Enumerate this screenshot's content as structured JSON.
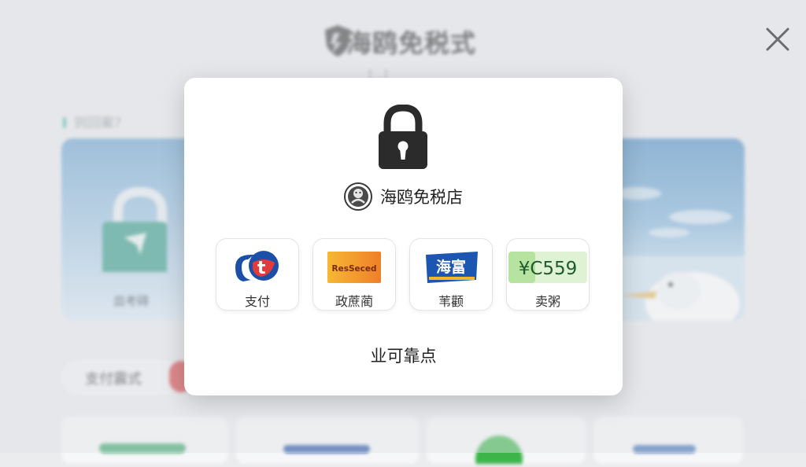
{
  "background": {
    "title": "海鸥免税式",
    "subtitle": "[...]",
    "section_label": "则回案?",
    "left_card_caption": "皿考碍",
    "payment_label": "支付震式"
  },
  "modal": {
    "brand_name": "海鸥免税店",
    "footer_text": "业可靠点",
    "payment_methods": [
      {
        "label": "支付",
        "logo_text": "t",
        "logo_icon": "payment-logo-icon"
      },
      {
        "label": "政蔗蔺",
        "logo_text": "ResSeced",
        "logo_icon": "orange-card-logo-icon"
      },
      {
        "label": "苇颧",
        "logo_text": "海富",
        "logo_icon": "blue-card-logo-icon"
      },
      {
        "label": "卖粥",
        "logo_text": "¥C559",
        "logo_icon": "green-price-logo-icon"
      }
    ]
  },
  "colors": {
    "accent_green": "#46b39d",
    "modal_bg": "#ffffff",
    "lock_dark": "#2b2b2b"
  }
}
